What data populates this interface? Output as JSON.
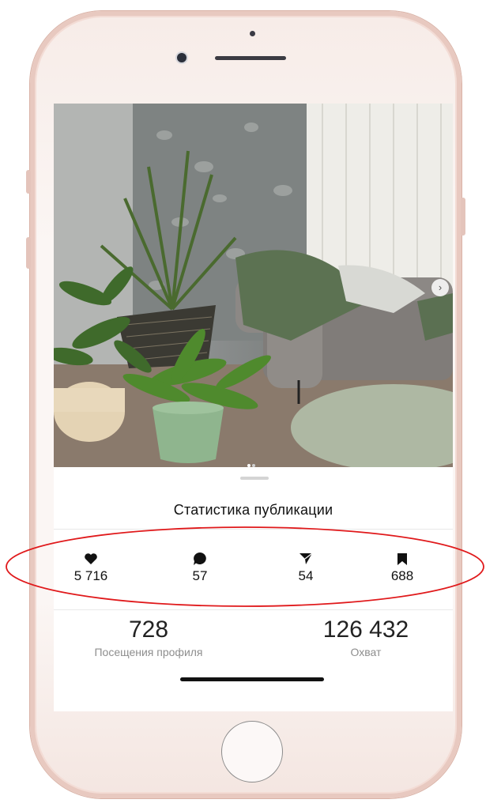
{
  "post": {
    "carousel": {
      "next_icon": "chevron-right-icon",
      "pages": 2,
      "current_page": 1
    }
  },
  "sheet": {
    "title": "Статистика публикации",
    "stats": [
      {
        "icon": "heart-icon",
        "value": "5 716"
      },
      {
        "icon": "comment-icon",
        "value": "57"
      },
      {
        "icon": "share-icon",
        "value": "54"
      },
      {
        "icon": "bookmark-icon",
        "value": "688"
      }
    ],
    "metrics": [
      {
        "value": "728",
        "label": "Посещения профиля"
      },
      {
        "value": "126 432",
        "label": "Охват"
      }
    ]
  },
  "colors": {
    "phone_frame": "#e8c9c0",
    "annotation": "#e0191b",
    "text_primary": "#111111",
    "text_secondary": "#8e8e8e"
  }
}
